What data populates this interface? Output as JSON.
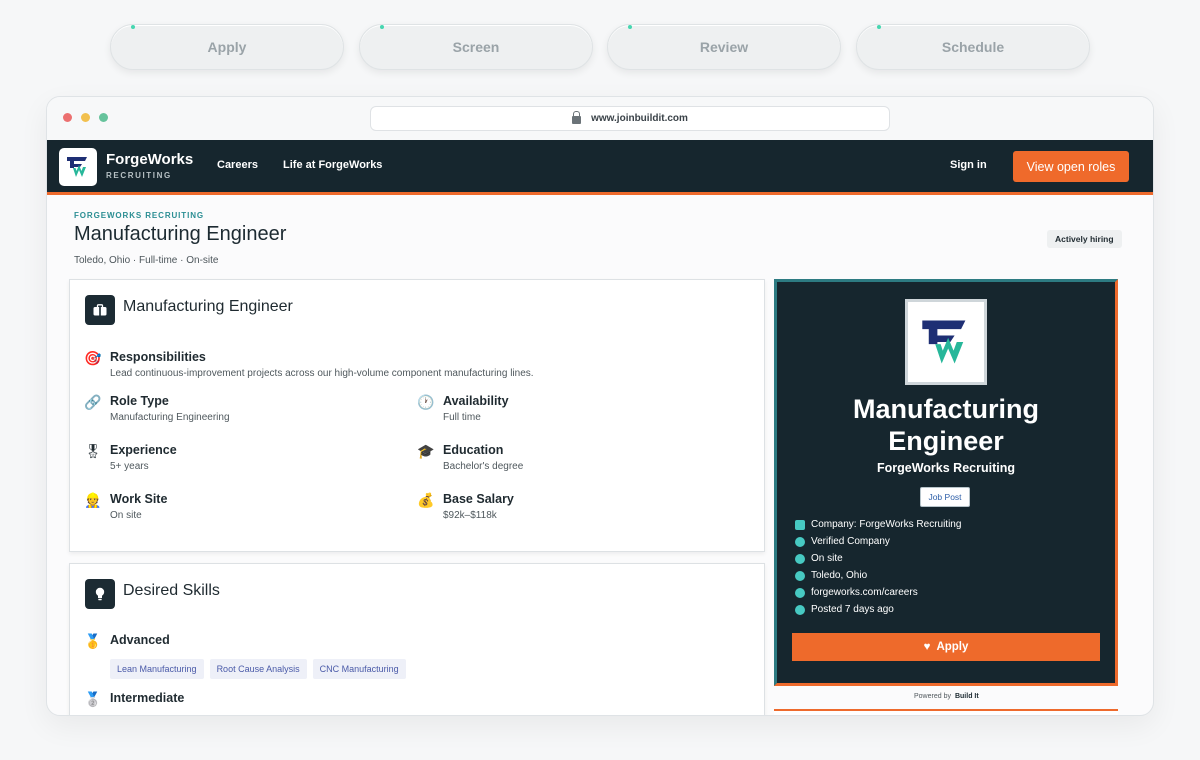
{
  "steps": [
    "Apply",
    "Screen",
    "Review",
    "Schedule"
  ],
  "browser": {
    "url": "www.joinbuildit.com"
  },
  "nav": {
    "brand_name": "ForgeWorks",
    "brand_sub": "RECRUITING",
    "links": [
      "Careers",
      "Life at ForgeWorks"
    ],
    "sign_in": "Sign in",
    "cta": "View open roles"
  },
  "job": {
    "eyebrow": "FORGEWORKS RECRUITING",
    "title": "Manufacturing Engineer",
    "meta": "Toledo, Ohio · Full-time · On-site",
    "hiring_badge": "Actively hiring"
  },
  "details_card": {
    "title": "Manufacturing Engineer",
    "icon": "briefcase-icon",
    "responsibilities": {
      "label": "Responsibilities",
      "value": "Lead continuous-improvement projects across our high-volume component manufacturing lines.",
      "icon": "target-icon"
    },
    "fields": [
      {
        "label": "Role Type",
        "value": "Manufacturing Engineering",
        "icon": "link-icon"
      },
      {
        "label": "Availability",
        "value": "Full time",
        "icon": "clock-icon"
      },
      {
        "label": "Experience",
        "value": "5+ years",
        "icon": "medal-icon"
      },
      {
        "label": "Education",
        "value": "Bachelor's degree",
        "icon": "graduation-cap-icon"
      },
      {
        "label": "Work Site",
        "value": "On site",
        "icon": "worker-icon"
      },
      {
        "label": "Base Salary",
        "value": "$92k–$118k",
        "icon": "money-bag-icon"
      }
    ]
  },
  "skills_card": {
    "title": "Desired Skills",
    "icon": "lightbulb-icon",
    "advanced_label": "Advanced",
    "advanced_skills": [
      "Lean Manufacturing",
      "Root Cause Analysis",
      "CNC Manufacturing"
    ],
    "intermediate_label": "Intermediate"
  },
  "sidebar": {
    "title_line1": "Manufacturing",
    "title_line2": "Engineer",
    "company": "ForgeWorks Recruiting",
    "badge": "Job Post",
    "facts": [
      {
        "text": "Company: ForgeWorks Recruiting",
        "icon": "briefcase-icon"
      },
      {
        "text": "Verified Company",
        "icon": "check-circle-icon"
      },
      {
        "text": "On site",
        "icon": "globe-icon"
      },
      {
        "text": "Toledo, Ohio",
        "icon": "map-pin-icon"
      },
      {
        "text": "forgeworks.com/careers",
        "icon": "link-icon"
      },
      {
        "text": "Posted 7 days ago",
        "icon": "clock-icon"
      }
    ],
    "apply_label": "Apply",
    "powered_by": "Powered by",
    "powered_brand": "Build It"
  },
  "colors": {
    "navy": "#16262e",
    "orange": "#ee6a2b",
    "teal": "#2b8e93",
    "chip_text": "#4a5aa8"
  }
}
